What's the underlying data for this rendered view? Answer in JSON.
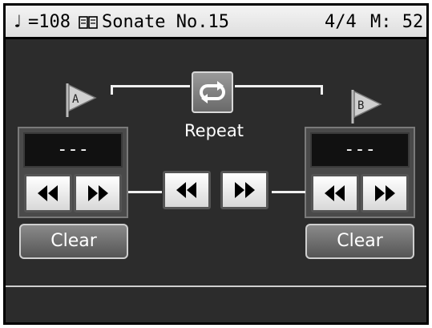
{
  "status_bar": {
    "note_glyph": "♩",
    "tempo": "=108",
    "song_title": "Sonate No.15",
    "time_signature": "4/4",
    "measure": "M: 52"
  },
  "marker_a": {
    "label": "A",
    "display": "---",
    "clear_label": "Clear"
  },
  "marker_b": {
    "label": "B",
    "display": "---",
    "clear_label": "Clear"
  },
  "repeat": {
    "label": "Repeat"
  },
  "icons": {
    "book": "book-icon",
    "rewind": "rewind-icon",
    "fast_forward": "fast-forward-icon",
    "repeat": "repeat-icon",
    "flag": "flag-icon"
  },
  "colors": {
    "background": "#2c2c2c",
    "status_bar": "#e8e8e8",
    "button": "#f0f0f0"
  }
}
